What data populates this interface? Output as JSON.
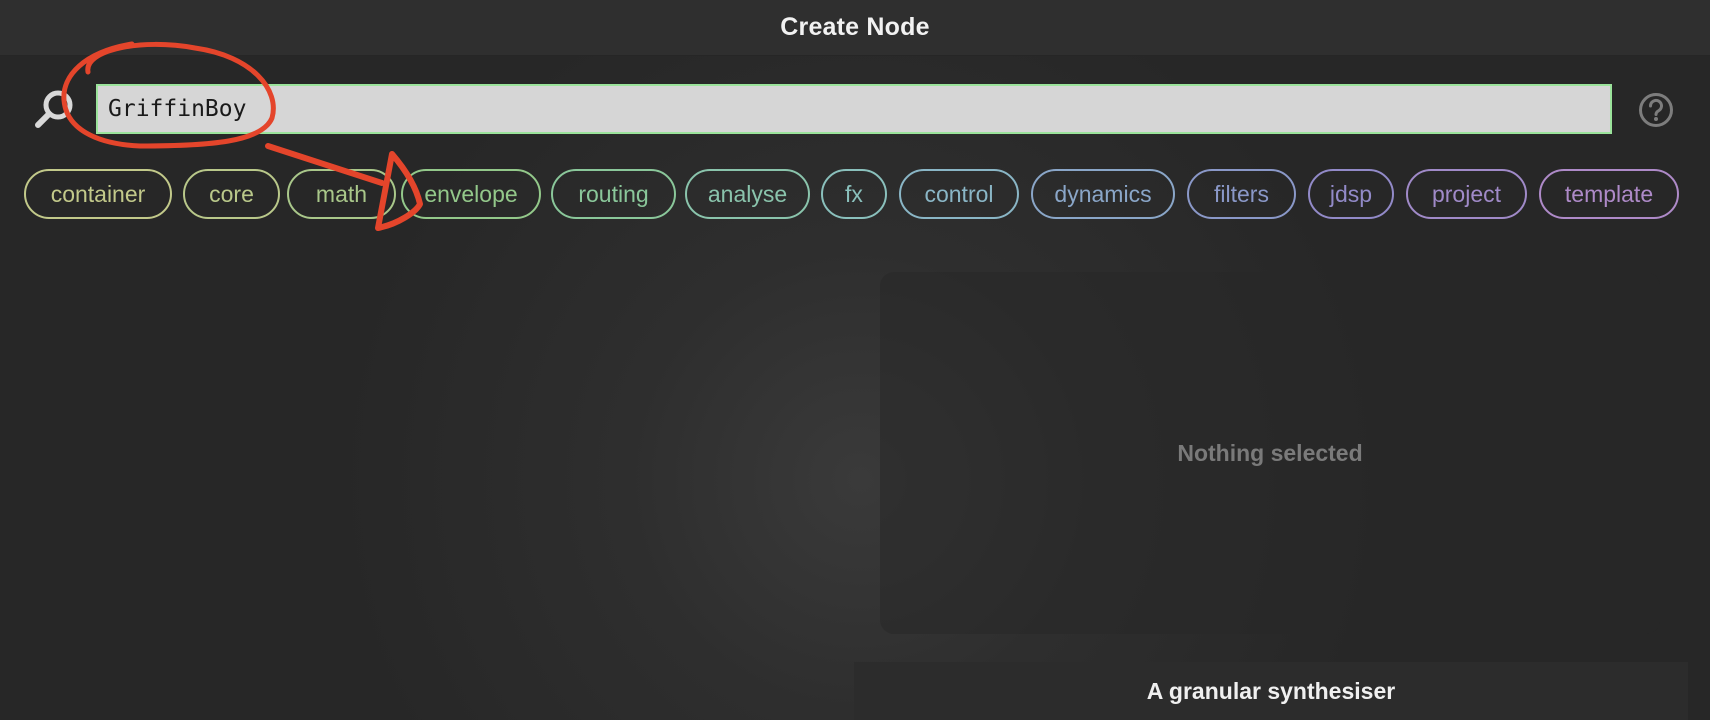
{
  "window": {
    "title": "Create Node"
  },
  "search": {
    "value": "GriffinBoy",
    "icon": "search-icon"
  },
  "help": {
    "icon": "help-circle-icon"
  },
  "tags": [
    {
      "label": "container",
      "color": "#c2c98a"
    },
    {
      "label": "core",
      "color": "#b9c88a"
    },
    {
      "label": "math",
      "color": "#a9c78a"
    },
    {
      "label": "envelope",
      "color": "#93c88a"
    },
    {
      "label": "routing",
      "color": "#8ac79a"
    },
    {
      "label": "analyse",
      "color": "#8ac4ac"
    },
    {
      "label": "fx",
      "color": "#8ac0bc"
    },
    {
      "label": "control",
      "color": "#8ab6c6"
    },
    {
      "label": "dynamics",
      "color": "#8aa6c8"
    },
    {
      "label": "filters",
      "color": "#8a98c8"
    },
    {
      "label": "jdsp",
      "color": "#928ac8"
    },
    {
      "label": "project",
      "color": "#a08ac8"
    },
    {
      "label": "template",
      "color": "#ae8ac8"
    }
  ],
  "details": {
    "empty_text": "Nothing selected"
  },
  "description": {
    "text": "A granular synthesiser"
  },
  "annotation_color": "#e4452b"
}
